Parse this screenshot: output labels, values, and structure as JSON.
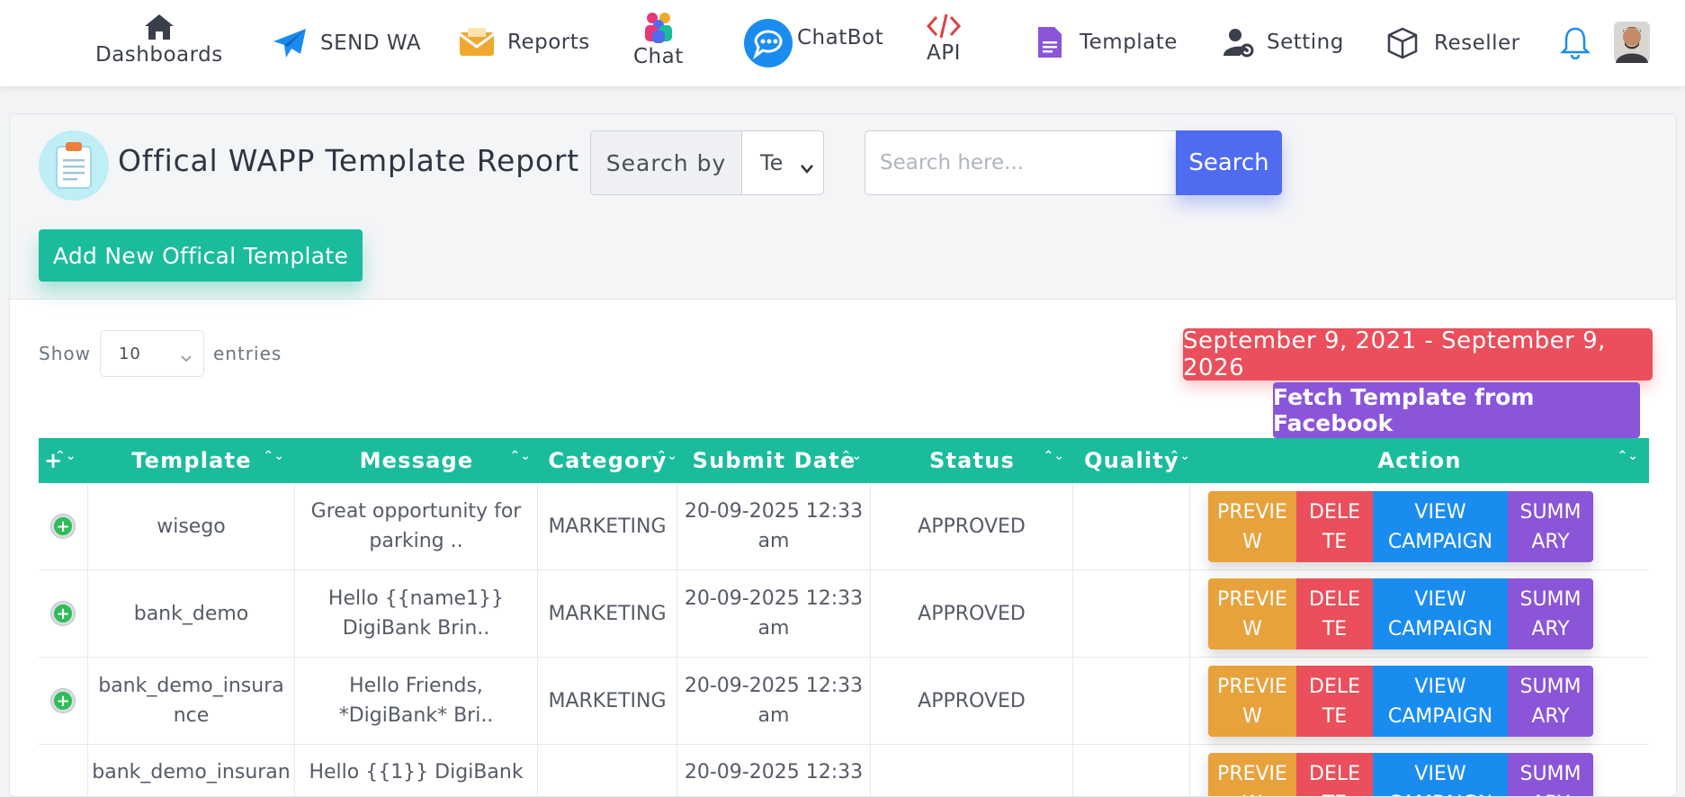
{
  "nav": {
    "dashboards": "Dashboards",
    "send_wa": "SEND WA",
    "reports": "Reports",
    "chat": "Chat",
    "chatbot": "ChatBot",
    "api": "API",
    "template": "Template",
    "setting": "Setting",
    "reseller": "Reseller"
  },
  "header": {
    "title": "Offical WAPP Template Report",
    "search_by_label": "Search by",
    "search_by_value": "Te",
    "search_placeholder": "Search here...",
    "search_button": "Search",
    "add_button": "Add New Offical Template"
  },
  "controls": {
    "show_label": "Show",
    "entries_value": "10",
    "entries_label": "entries",
    "date_range": "September 9, 2021 - September 9, 2026",
    "fetch_button": "Fetch Template from Facebook"
  },
  "table": {
    "columns": {
      "expand": "+",
      "template": "Template",
      "message": "Message",
      "category": "Category",
      "submit_date": "Submit Date",
      "status": "Status",
      "quality": "Quality",
      "action": "Action"
    },
    "action_labels": {
      "preview": "PREVIE W",
      "delete": "DELE TE",
      "view": "VIEW CAMPAIGN",
      "summary": "SUMM ARY"
    },
    "rows": [
      {
        "template": "wisego",
        "message": "Great opportunity for parking ..",
        "category": "MARKETING",
        "date": "20-09-2025 12:33 am",
        "status": "APPROVED",
        "quality": ""
      },
      {
        "template": "bank_demo",
        "message": "Hello {{name1}} DigiBank Brin..",
        "category": "MARKETING",
        "date": "20-09-2025 12:33 am",
        "status": "APPROVED",
        "quality": ""
      },
      {
        "template": "bank_demo_insurance",
        "message": "Hello Friends, *DigiBank* Bri..",
        "category": "MARKETING",
        "date": "20-09-2025 12:33 am",
        "status": "APPROVED",
        "quality": ""
      },
      {
        "template": "bank_demo_insuran",
        "message": "Hello {{1}} DigiBank",
        "category": "",
        "date": "20-09-2025 12:33",
        "status": "",
        "quality": ""
      }
    ]
  },
  "colors": {
    "primary": "#1abc9c",
    "search": "#4f6cf1",
    "danger": "#ea4f5b",
    "purple": "#8a55d8",
    "warning": "#e8a23c",
    "info": "#1a8cf0"
  }
}
